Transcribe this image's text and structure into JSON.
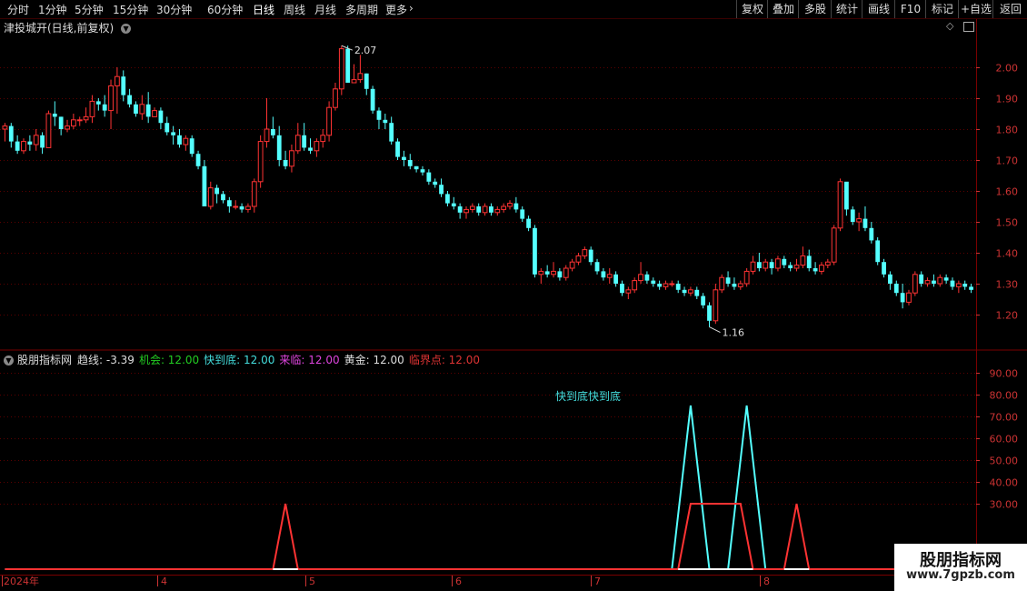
{
  "toolbar": {
    "periods": [
      "分时",
      "1分钟",
      "5分钟",
      "15分钟",
      "30分钟",
      "60分钟",
      "日线",
      "周线",
      "月线",
      "多周期",
      "更多"
    ],
    "active_period": "日线",
    "right_buttons": [
      "复权",
      "叠加",
      "多股",
      "统计",
      "画线",
      "F10",
      "标记",
      "+自选",
      "返回"
    ]
  },
  "main_chart": {
    "title": "津投城开(日线,前复权)",
    "high_marker": "2.07",
    "low_marker": "1.16"
  },
  "indicator": {
    "name": "股朋指标网",
    "items": [
      {
        "label": "趋线:",
        "value": "-3.39",
        "color": "#dddddd"
      },
      {
        "label": "机会:",
        "value": "12.00",
        "color": "#22cc22"
      },
      {
        "label": "快到底:",
        "value": "12.00",
        "color": "#44dddd"
      },
      {
        "label": "来临:",
        "value": "12.00",
        "color": "#dd44dd"
      },
      {
        "label": "黄金:",
        "value": "12.00",
        "color": "#dddddd"
      },
      {
        "label": "临界点:",
        "value": "12.00",
        "color": "#dd3333"
      }
    ],
    "annotation": "快到底快到底"
  },
  "x_axis": {
    "year_label": "2024年",
    "month_labels": [
      "4",
      "5",
      "6",
      "7",
      "8"
    ]
  },
  "watermark": {
    "line1": "股朋指标网",
    "line2": "www.7gpzb.com"
  },
  "colors": {
    "up": "#ff3333",
    "down": "#54ffff",
    "grid": "#5a0000",
    "axis_text": "#cc3333"
  },
  "chart_data": [
    {
      "type": "candlestick",
      "y_ticks": [
        1.2,
        1.3,
        1.4,
        1.5,
        1.6,
        1.7,
        1.8,
        1.9,
        2.0
      ],
      "ylim": [
        1.1,
        2.1
      ],
      "candles": [
        [
          1.8,
          1.82,
          1.76,
          1.81
        ],
        [
          1.81,
          1.82,
          1.74,
          1.76
        ],
        [
          1.76,
          1.78,
          1.72,
          1.73
        ],
        [
          1.73,
          1.77,
          1.72,
          1.76
        ],
        [
          1.76,
          1.78,
          1.73,
          1.75
        ],
        [
          1.75,
          1.8,
          1.73,
          1.78
        ],
        [
          1.78,
          1.79,
          1.72,
          1.74
        ],
        [
          1.74,
          1.86,
          1.74,
          1.85
        ],
        [
          1.85,
          1.89,
          1.81,
          1.84
        ],
        [
          1.84,
          1.84,
          1.78,
          1.8
        ],
        [
          1.8,
          1.83,
          1.79,
          1.81
        ],
        [
          1.81,
          1.85,
          1.8,
          1.83
        ],
        [
          1.83,
          1.84,
          1.81,
          1.83
        ],
        [
          1.83,
          1.87,
          1.82,
          1.84
        ],
        [
          1.84,
          1.91,
          1.82,
          1.89
        ],
        [
          1.89,
          1.9,
          1.86,
          1.88
        ],
        [
          1.88,
          1.91,
          1.84,
          1.86
        ],
        [
          1.86,
          1.96,
          1.8,
          1.94
        ],
        [
          1.94,
          2.0,
          1.85,
          1.97
        ],
        [
          1.97,
          1.99,
          1.89,
          1.91
        ],
        [
          1.91,
          1.93,
          1.87,
          1.88
        ],
        [
          1.88,
          1.89,
          1.84,
          1.85
        ],
        [
          1.85,
          1.91,
          1.83,
          1.88
        ],
        [
          1.88,
          1.92,
          1.82,
          1.84
        ],
        [
          1.84,
          1.87,
          1.85,
          1.86
        ],
        [
          1.86,
          1.87,
          1.8,
          1.82
        ],
        [
          1.82,
          1.84,
          1.78,
          1.79
        ],
        [
          1.79,
          1.81,
          1.75,
          1.78
        ],
        [
          1.78,
          1.8,
          1.74,
          1.75
        ],
        [
          1.75,
          1.78,
          1.73,
          1.77
        ],
        [
          1.77,
          1.78,
          1.71,
          1.72
        ],
        [
          1.72,
          1.73,
          1.67,
          1.68
        ],
        [
          1.68,
          1.7,
          1.55,
          1.55
        ],
        [
          1.55,
          1.63,
          1.54,
          1.61
        ],
        [
          1.61,
          1.62,
          1.56,
          1.59
        ],
        [
          1.59,
          1.6,
          1.56,
          1.57
        ],
        [
          1.57,
          1.58,
          1.53,
          1.55
        ],
        [
          1.55,
          1.57,
          1.54,
          1.55
        ],
        [
          1.55,
          1.56,
          1.53,
          1.54
        ],
        [
          1.54,
          1.56,
          1.53,
          1.55
        ],
        [
          1.55,
          1.64,
          1.53,
          1.63
        ],
        [
          1.63,
          1.78,
          1.61,
          1.76
        ],
        [
          1.76,
          1.9,
          1.74,
          1.8
        ],
        [
          1.8,
          1.84,
          1.77,
          1.78
        ],
        [
          1.78,
          1.81,
          1.68,
          1.7
        ],
        [
          1.7,
          1.73,
          1.67,
          1.68
        ],
        [
          1.68,
          1.75,
          1.66,
          1.73
        ],
        [
          1.73,
          1.82,
          1.72,
          1.78
        ],
        [
          1.78,
          1.82,
          1.73,
          1.74
        ],
        [
          1.74,
          1.77,
          1.72,
          1.73
        ],
        [
          1.73,
          1.77,
          1.71,
          1.76
        ],
        [
          1.76,
          1.8,
          1.74,
          1.78
        ],
        [
          1.78,
          1.89,
          1.76,
          1.87
        ],
        [
          1.87,
          1.95,
          1.86,
          1.93
        ],
        [
          1.93,
          2.07,
          1.91,
          2.06
        ],
        [
          2.06,
          2.07,
          1.95,
          1.95
        ],
        [
          1.95,
          2.01,
          1.95,
          1.96
        ],
        [
          1.96,
          2.04,
          1.95,
          1.98
        ],
        [
          1.98,
          1.98,
          1.91,
          1.93
        ],
        [
          1.93,
          1.94,
          1.85,
          1.86
        ],
        [
          1.86,
          1.87,
          1.8,
          1.83
        ],
        [
          1.83,
          1.85,
          1.8,
          1.82
        ],
        [
          1.82,
          1.84,
          1.75,
          1.76
        ],
        [
          1.76,
          1.77,
          1.7,
          1.71
        ],
        [
          1.71,
          1.73,
          1.68,
          1.7
        ],
        [
          1.7,
          1.72,
          1.67,
          1.68
        ],
        [
          1.68,
          1.68,
          1.66,
          1.67
        ],
        [
          1.67,
          1.68,
          1.65,
          1.66
        ],
        [
          1.66,
          1.67,
          1.62,
          1.63
        ],
        [
          1.63,
          1.64,
          1.61,
          1.62
        ],
        [
          1.62,
          1.64,
          1.58,
          1.59
        ],
        [
          1.59,
          1.6,
          1.55,
          1.56
        ],
        [
          1.56,
          1.58,
          1.54,
          1.55
        ],
        [
          1.55,
          1.56,
          1.51,
          1.53
        ],
        [
          1.53,
          1.55,
          1.51,
          1.54
        ],
        [
          1.54,
          1.56,
          1.53,
          1.55
        ],
        [
          1.55,
          1.56,
          1.52,
          1.53
        ],
        [
          1.53,
          1.56,
          1.52,
          1.55
        ],
        [
          1.55,
          1.56,
          1.52,
          1.53
        ],
        [
          1.53,
          1.55,
          1.52,
          1.54
        ],
        [
          1.54,
          1.56,
          1.53,
          1.55
        ],
        [
          1.55,
          1.57,
          1.54,
          1.56
        ],
        [
          1.56,
          1.58,
          1.53,
          1.54
        ],
        [
          1.54,
          1.55,
          1.5,
          1.51
        ],
        [
          1.51,
          1.52,
          1.47,
          1.48
        ],
        [
          1.48,
          1.49,
          1.32,
          1.33
        ],
        [
          1.33,
          1.35,
          1.3,
          1.34
        ],
        [
          1.34,
          1.36,
          1.32,
          1.33
        ],
        [
          1.33,
          1.37,
          1.32,
          1.34
        ],
        [
          1.34,
          1.35,
          1.31,
          1.32
        ],
        [
          1.32,
          1.36,
          1.31,
          1.35
        ],
        [
          1.35,
          1.38,
          1.34,
          1.37
        ],
        [
          1.37,
          1.4,
          1.36,
          1.39
        ],
        [
          1.39,
          1.42,
          1.38,
          1.41
        ],
        [
          1.41,
          1.42,
          1.36,
          1.37
        ],
        [
          1.37,
          1.38,
          1.33,
          1.34
        ],
        [
          1.34,
          1.35,
          1.31,
          1.32
        ],
        [
          1.32,
          1.35,
          1.3,
          1.33
        ],
        [
          1.33,
          1.34,
          1.29,
          1.3
        ],
        [
          1.3,
          1.31,
          1.26,
          1.27
        ],
        [
          1.27,
          1.29,
          1.25,
          1.28
        ],
        [
          1.28,
          1.32,
          1.27,
          1.31
        ],
        [
          1.31,
          1.37,
          1.3,
          1.33
        ],
        [
          1.33,
          1.34,
          1.3,
          1.31
        ],
        [
          1.31,
          1.32,
          1.29,
          1.3
        ],
        [
          1.3,
          1.31,
          1.28,
          1.29
        ],
        [
          1.29,
          1.31,
          1.28,
          1.3
        ],
        [
          1.3,
          1.31,
          1.29,
          1.3
        ],
        [
          1.3,
          1.31,
          1.27,
          1.28
        ],
        [
          1.28,
          1.29,
          1.26,
          1.27
        ],
        [
          1.27,
          1.29,
          1.26,
          1.28
        ],
        [
          1.28,
          1.29,
          1.25,
          1.26
        ],
        [
          1.26,
          1.27,
          1.22,
          1.23
        ],
        [
          1.23,
          1.24,
          1.16,
          1.18
        ],
        [
          1.18,
          1.3,
          1.17,
          1.28
        ],
        [
          1.28,
          1.33,
          1.27,
          1.32
        ],
        [
          1.32,
          1.34,
          1.29,
          1.3
        ],
        [
          1.3,
          1.32,
          1.28,
          1.29
        ],
        [
          1.29,
          1.31,
          1.28,
          1.3
        ],
        [
          1.3,
          1.35,
          1.29,
          1.34
        ],
        [
          1.34,
          1.39,
          1.33,
          1.37
        ],
        [
          1.37,
          1.4,
          1.34,
          1.35
        ],
        [
          1.35,
          1.38,
          1.34,
          1.37
        ],
        [
          1.37,
          1.38,
          1.33,
          1.35
        ],
        [
          1.35,
          1.39,
          1.34,
          1.38
        ],
        [
          1.38,
          1.39,
          1.35,
          1.36
        ],
        [
          1.36,
          1.37,
          1.34,
          1.35
        ],
        [
          1.35,
          1.38,
          1.34,
          1.36
        ],
        [
          1.36,
          1.42,
          1.35,
          1.39
        ],
        [
          1.39,
          1.41,
          1.34,
          1.35
        ],
        [
          1.35,
          1.37,
          1.33,
          1.34
        ],
        [
          1.34,
          1.37,
          1.33,
          1.36
        ],
        [
          1.36,
          1.38,
          1.35,
          1.37
        ],
        [
          1.37,
          1.49,
          1.36,
          1.48
        ],
        [
          1.48,
          1.64,
          1.47,
          1.63
        ],
        [
          1.63,
          1.62,
          1.52,
          1.54
        ],
        [
          1.54,
          1.55,
          1.49,
          1.5
        ],
        [
          1.5,
          1.53,
          1.47,
          1.51
        ],
        [
          1.51,
          1.55,
          1.47,
          1.48
        ],
        [
          1.48,
          1.5,
          1.43,
          1.44
        ],
        [
          1.44,
          1.45,
          1.36,
          1.37
        ],
        [
          1.37,
          1.38,
          1.32,
          1.33
        ],
        [
          1.33,
          1.34,
          1.28,
          1.3
        ],
        [
          1.3,
          1.31,
          1.26,
          1.27
        ],
        [
          1.27,
          1.3,
          1.22,
          1.24
        ],
        [
          1.24,
          1.28,
          1.23,
          1.27
        ],
        [
          1.27,
          1.34,
          1.26,
          1.33
        ],
        [
          1.33,
          1.34,
          1.29,
          1.3
        ],
        [
          1.3,
          1.32,
          1.29,
          1.31
        ],
        [
          1.31,
          1.33,
          1.29,
          1.3
        ],
        [
          1.3,
          1.33,
          1.29,
          1.32
        ],
        [
          1.32,
          1.33,
          1.3,
          1.31
        ],
        [
          1.31,
          1.32,
          1.28,
          1.29
        ],
        [
          1.29,
          1.31,
          1.27,
          1.3
        ],
        [
          1.3,
          1.31,
          1.28,
          1.29
        ],
        [
          1.29,
          1.3,
          1.27,
          1.28
        ]
      ]
    },
    {
      "type": "line",
      "y_ticks": [
        30,
        40,
        50,
        60,
        70,
        80,
        90
      ],
      "ylim": [
        0,
        95
      ],
      "series": [
        {
          "color": "#54ffff",
          "points": [
            [
              0,
              0
            ],
            [
              107,
              0
            ],
            [
              110,
              75
            ],
            [
              113,
              0
            ],
            [
              116,
              0
            ],
            [
              119,
              75
            ],
            [
              122,
              0
            ],
            [
              180,
              0
            ]
          ]
        },
        {
          "color": "#ff3333",
          "points": [
            [
              0,
              0
            ],
            [
              43,
              0
            ],
            [
              45,
              30
            ],
            [
              47,
              0
            ],
            [
              108,
              0
            ],
            [
              110,
              30
            ],
            [
              118,
              30
            ],
            [
              120,
              0
            ],
            [
              125,
              0
            ],
            [
              127,
              30
            ],
            [
              129,
              0
            ],
            [
              180,
              0
            ]
          ]
        },
        {
          "color": "#ffffff",
          "points": [
            [
              43,
              0
            ],
            [
              47,
              0
            ],
            [
              108,
              0
            ],
            [
              120,
              0
            ],
            [
              125,
              0
            ],
            [
              129,
              0
            ]
          ]
        }
      ]
    }
  ]
}
